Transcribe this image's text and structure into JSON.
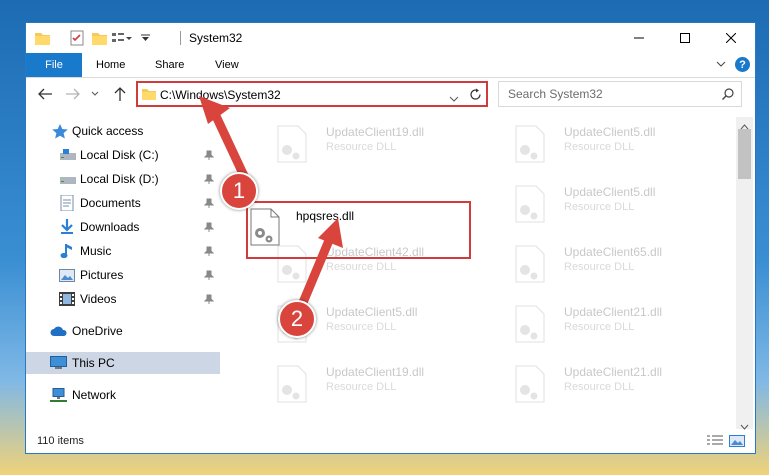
{
  "window": {
    "title": "System32"
  },
  "ribbon": {
    "file": "File",
    "tabs": [
      "Home",
      "Share",
      "View"
    ],
    "help": "?"
  },
  "address": {
    "path": "C:\\Windows\\System32"
  },
  "search": {
    "placeholder": "Search System32"
  },
  "sidebar": {
    "quick_access": "Quick access",
    "items": [
      "Local Disk (C:)",
      "Local Disk (D:)",
      "Documents",
      "Downloads",
      "Music",
      "Pictures",
      "Videos"
    ],
    "onedrive": "OneDrive",
    "this_pc": "This PC",
    "network": "Network"
  },
  "files": {
    "left": [
      {
        "name": "UpdateClient19.dll",
        "type": "Resource DLL"
      },
      {
        "name": "UpdateClient42.dll",
        "type": "Resource DLL"
      },
      {
        "name": "UpdateClient5.dll",
        "type": "Resource DLL"
      },
      {
        "name": "UpdateClient19.dll",
        "type": "Resource DLL"
      }
    ],
    "right": [
      {
        "name": "UpdateClient5.dll",
        "type": "Resource DLL"
      },
      {
        "name": "UpdateClient5.dll",
        "type": "Resource DLL"
      },
      {
        "name": "UpdateClient65.dll",
        "type": "Resource DLL"
      },
      {
        "name": "UpdateClient21.dll",
        "type": "Resource DLL"
      },
      {
        "name": "UpdateClient21.dll",
        "type": "Resource DLL"
      }
    ],
    "highlighted": {
      "name": "hpqsres.dll"
    }
  },
  "callouts": {
    "one": "1",
    "two": "2"
  },
  "status": {
    "count": "110 items"
  },
  "colors": {
    "accent": "#1979ca",
    "callout": "#d9453d"
  }
}
